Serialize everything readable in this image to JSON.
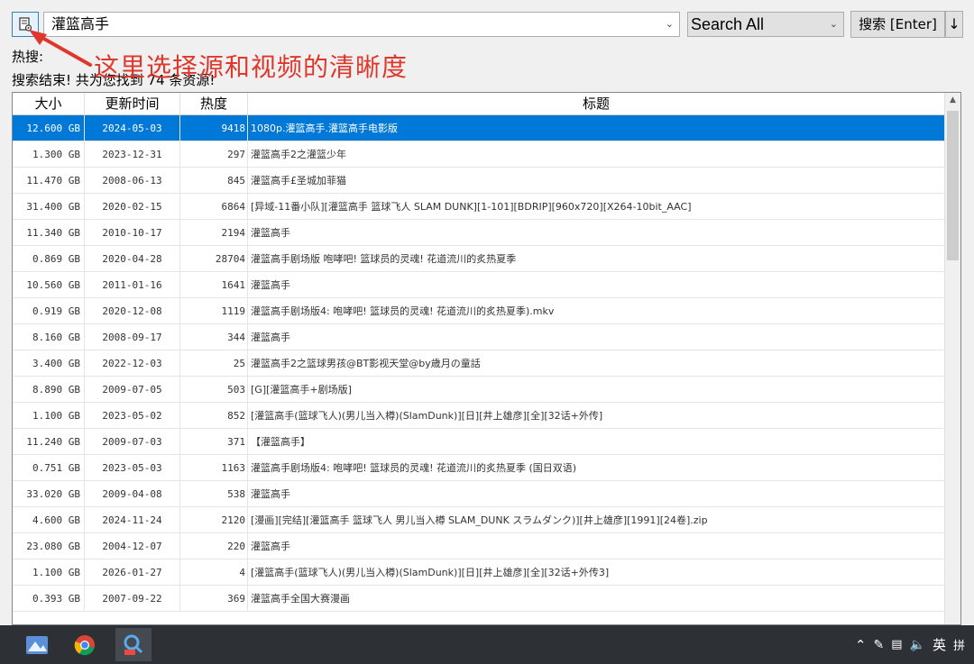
{
  "toolbar": {
    "query_value": "灌篮高手",
    "scope_value": "Search All",
    "search_label": "搜索 [Enter]",
    "sort_label": "↓"
  },
  "hot_label": "热搜:",
  "status_text": "搜索结束! 共为您找到 74 条资源!",
  "annotation": "这里选择源和视频的清晰度",
  "table": {
    "headers": [
      "大小",
      "更新时间",
      "热度",
      "标题"
    ],
    "rows": [
      {
        "size": "12.600 GB",
        "date": "2024-05-03",
        "heat": "9418",
        "title": "1080p.灌篮高手.灌篮高手电影版"
      },
      {
        "size": "1.300 GB",
        "date": "2023-12-31",
        "heat": "297",
        "title": "灌篮高手2之灌篮少年"
      },
      {
        "size": "11.470 GB",
        "date": "2008-06-13",
        "heat": "845",
        "title": "灌篮高手£圣城加菲猫"
      },
      {
        "size": "31.400 GB",
        "date": "2020-02-15",
        "heat": "6864",
        "title": "[异域-11番小队][灌篮高手 篮球飞人 SLAM DUNK][1-101][BDRIP][960x720][X264-10bit_AAC]"
      },
      {
        "size": "11.340 GB",
        "date": "2010-10-17",
        "heat": "2194",
        "title": "灌篮高手"
      },
      {
        "size": "0.869 GB",
        "date": "2020-04-28",
        "heat": "28704",
        "title": "灌篮高手剧场版 咆哮吧! 篮球员的灵魂! 花道流川的炙热夏季"
      },
      {
        "size": "10.560 GB",
        "date": "2011-01-16",
        "heat": "1641",
        "title": "灌篮高手"
      },
      {
        "size": "0.919 GB",
        "date": "2020-12-08",
        "heat": "1119",
        "title": "灌篮高手剧场版4: 咆哮吧! 篮球员的灵魂! 花道流川的炙热夏季).mkv"
      },
      {
        "size": "8.160 GB",
        "date": "2008-09-17",
        "heat": "344",
        "title": "灌篮高手"
      },
      {
        "size": "3.400 GB",
        "date": "2022-12-03",
        "heat": "25",
        "title": "灌篮高手2之篮球男孩@BT影视天堂@by歳月の童話"
      },
      {
        "size": "8.890 GB",
        "date": "2009-07-05",
        "heat": "503",
        "title": "[G][灌篮高手+剧场版]"
      },
      {
        "size": "1.100 GB",
        "date": "2023-05-02",
        "heat": "852",
        "title": "[灌篮高手(篮球飞人)(男儿当入樽)(SlamDunk)][日][井上雄彦][全][32话+外传]"
      },
      {
        "size": "11.240 GB",
        "date": "2009-07-03",
        "heat": "371",
        "title": "【灌篮高手】"
      },
      {
        "size": "0.751 GB",
        "date": "2023-05-03",
        "heat": "1163",
        "title": "灌篮高手剧场版4: 咆哮吧! 篮球员的灵魂! 花道流川的炙热夏季 (国日双语)"
      },
      {
        "size": "33.020 GB",
        "date": "2009-04-08",
        "heat": "538",
        "title": "灌篮高手"
      },
      {
        "size": "4.600 GB",
        "date": "2024-11-24",
        "heat": "2120",
        "title": "[漫画][完结][灌篮高手 篮球飞人 男儿当入樽 SLAM_DUNK スラムダンク)][井上雄彦][1991][24卷].zip"
      },
      {
        "size": "23.080 GB",
        "date": "2004-12-07",
        "heat": "220",
        "title": "灌篮高手"
      },
      {
        "size": "1.100 GB",
        "date": "2026-01-27",
        "heat": "4",
        "title": "[灌篮高手(篮球飞人)(男儿当入樽)(SlamDunk)][日][井上雄彦][全][32话+外传3]"
      },
      {
        "size": "0.393 GB",
        "date": "2007-09-22",
        "heat": "369",
        "title": "灌篮高手全国大赛漫画"
      }
    ]
  },
  "taskbar": {
    "tray_lang": "英",
    "tray_ime": "拼"
  }
}
